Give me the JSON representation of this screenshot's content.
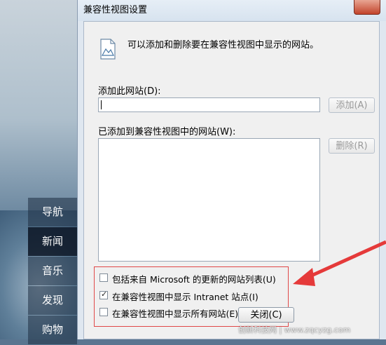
{
  "dialog": {
    "title": "兼容性视图设置",
    "info_text": "可以添加和删除要在兼容性视图中显示的网站。",
    "add_site_label": "添加此网站(D):",
    "add_site_value": "",
    "add_button": "添加(A)",
    "added_sites_label": "已添加到兼容性视图中的网站(W):",
    "remove_button": "删除(R)",
    "close_button": "关闭(C)",
    "options": [
      {
        "label": "包括来自 Microsoft 的更新的网站列表(U)",
        "checked": false
      },
      {
        "label": "在兼容性视图中显示 Intranet 站点(I)",
        "checked": true
      },
      {
        "label": "在兼容性视图中显示所有网站(E)",
        "checked": false
      }
    ]
  },
  "sidebar": {
    "items": [
      {
        "label": "导航"
      },
      {
        "label": "新闻"
      },
      {
        "label": "音乐"
      },
      {
        "label": "发现"
      },
      {
        "label": "购物"
      }
    ]
  },
  "watermark": "创新科技网 | www.zqcyzg.com",
  "colors": {
    "highlight_box": "#e04848",
    "arrow": "#e53a3a"
  }
}
